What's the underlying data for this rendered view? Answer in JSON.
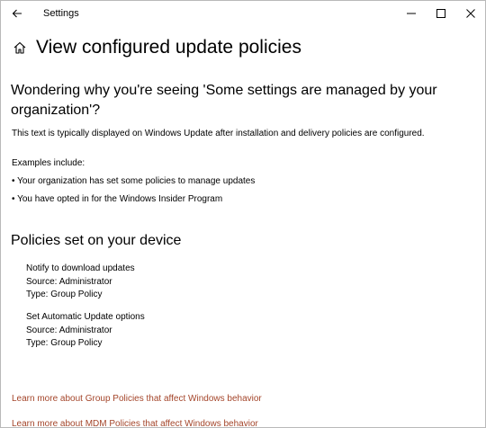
{
  "window": {
    "title": "Settings"
  },
  "header": {
    "title": "View configured update policies"
  },
  "intro": {
    "heading_line1": "Wondering why you're seeing 'Some settings are managed by your",
    "heading_line2": "organization'?",
    "description": "This text is typically displayed on Windows Update after installation and delivery policies are configured.",
    "examples_label": "Examples include:",
    "examples": [
      "• Your organization has set some policies to manage updates",
      "• You have opted in for the Windows Insider Program"
    ]
  },
  "policies": {
    "heading": "Policies set on your device",
    "items": [
      {
        "name": "Notify to download updates",
        "source": "Source: Administrator",
        "type": "Type: Group Policy"
      },
      {
        "name": "Set Automatic Update options",
        "source": "Source: Administrator",
        "type": "Type: Group Policy"
      }
    ]
  },
  "links": [
    "Learn more about Group Policies that affect Windows behavior",
    "Learn more about MDM Policies that affect Windows behavior"
  ],
  "colors": {
    "link": "#a4452a",
    "background": "#ffffff",
    "text": "#000000"
  },
  "icons": {
    "back": "back-arrow-icon",
    "home": "home-icon",
    "minimize": "minimize-icon",
    "maximize": "maximize-icon",
    "close": "close-icon"
  }
}
